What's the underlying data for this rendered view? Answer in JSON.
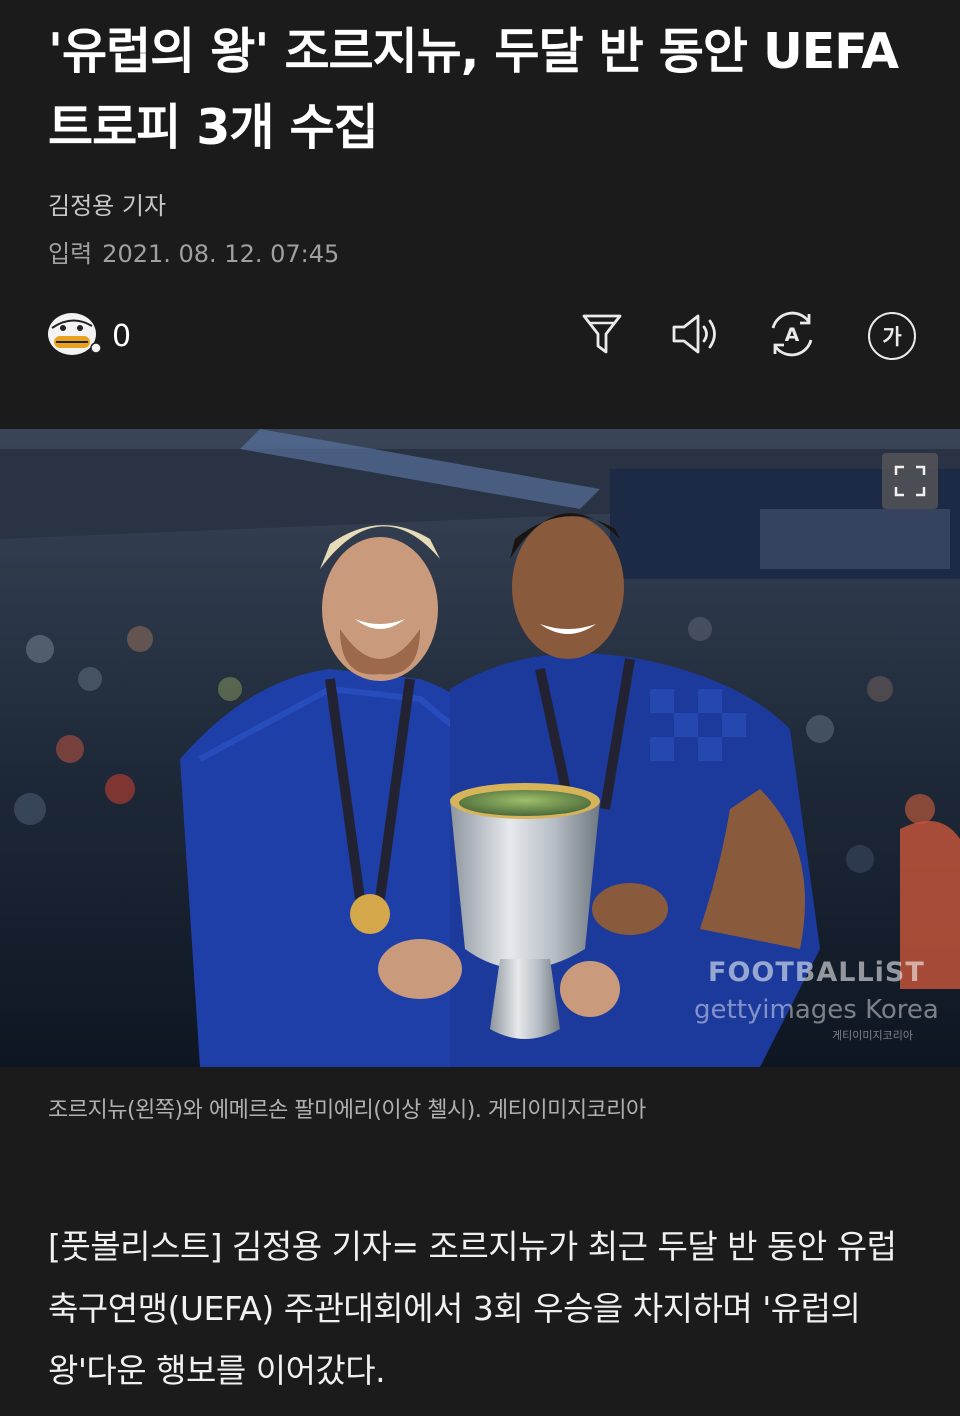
{
  "article": {
    "headline": "'유럽의 왕' 조르지뉴, 두달 반 동안 UEFA 트로피 3개 수집",
    "reporter": "김정용 기자",
    "date_label": "입력",
    "date_value": "2021. 08. 12. 07:45"
  },
  "toolbar": {
    "reaction_count": "0",
    "font_label": "가",
    "translate_glyph": "A"
  },
  "photo": {
    "watermark_brand": "FOOTBALLiST",
    "watermark_agency": "gettyimages Korea",
    "watermark_small": "게티이미지코리아",
    "caption": "조르지뉴(왼쪽)와 에메르손 팔미에리(이상 첼시). 게티이미지코리아"
  },
  "body": {
    "paragraph": "[풋볼리스트] 김정용 기자= 조르지뉴가 최근 두달 반 동안 유럽축구연맹(UEFA) 주관대회에서 3회 우승을 차지하며 '유럽의 왕'다운 행보를 이어갔다."
  },
  "colors": {
    "background": "#1b1b1b",
    "chelsea_blue": "#1f3fa8",
    "trophy_silver": "#c9cdd2"
  },
  "icons": [
    "emoji-reaction-icon",
    "filter-icon",
    "speaker-icon",
    "auto-translate-icon",
    "font-size-icon",
    "expand-icon"
  ]
}
